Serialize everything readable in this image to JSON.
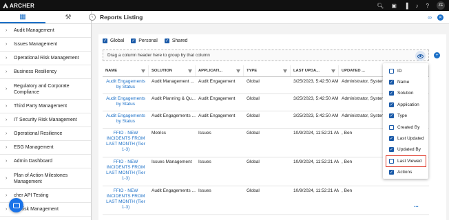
{
  "app": {
    "brand": "ARCHER",
    "user_initials": "ZE"
  },
  "header": {
    "title": "Reports Listing"
  },
  "sidebar": {
    "items": [
      {
        "label": "Audit Management"
      },
      {
        "label": "Issues Management"
      },
      {
        "label": "Operational Risk Management"
      },
      {
        "label": "Business Resiliency"
      },
      {
        "label": "Regulatory and Corporate Compliance"
      },
      {
        "label": "Third Party Management"
      },
      {
        "label": "IT Security Risk Management"
      },
      {
        "label": "Operational Resilience"
      },
      {
        "label": "ESG Management"
      },
      {
        "label": "Admin Dashboard"
      },
      {
        "label": "Plan of Action Milestones Management"
      },
      {
        "label": "cher API Testing"
      },
      {
        "label": "AI Risk Management"
      }
    ]
  },
  "filters": {
    "global": "Global",
    "personal": "Personal",
    "shared": "Shared"
  },
  "groupbar": {
    "text": "Drag a column header here to group by that column"
  },
  "columns": {
    "name": "NAME",
    "solution": "SOLUTION",
    "application": "APPLICATI...",
    "type": "TYPE",
    "last_updated": "LAST UPDA...",
    "updated_by": "UPDATED ..."
  },
  "rows": [
    {
      "name": "Audit Engagements by Status",
      "solution": "Audit Management ...",
      "application": "Audit Engagement",
      "type": "Global",
      "last_updated": "3/25/2023, 5:42:50 AM",
      "updated_by": "Administrator, System"
    },
    {
      "name": "Audit Engagements by Status",
      "solution": "Audit Planning & Qu...",
      "application": "Audit Engagement",
      "type": "Global",
      "last_updated": "3/25/2023, 5:42:50 AM",
      "updated_by": "Administrator, System"
    },
    {
      "name": "Audit Engagements by Status",
      "solution": "Audit Engagements ...",
      "application": "Audit Engagement",
      "type": "Global",
      "last_updated": "3/25/2023, 5:42:50 AM",
      "updated_by": "Administrator, System"
    },
    {
      "name": "FFIO - NEW INCIDENTS FROM LAST MONTH (Tier 1-3)",
      "solution": "Metrics",
      "application": "Issues",
      "type": "Global",
      "last_updated": "10/9/2024, 11:52:21 AM",
      "updated_by": ", Ben"
    },
    {
      "name": "FFIO - NEW INCIDENTS FROM LAST MONTH (Tier 1-3)",
      "solution": "Issues Management",
      "application": "Issues",
      "type": "Global",
      "last_updated": "10/9/2024, 11:52:21 AM",
      "updated_by": ", Ben"
    },
    {
      "name": "FFIO - NEW INCIDENTS FROM LAST MONTH (Tier 1-3)",
      "solution": "Audit Engagements ...",
      "application": "Issues",
      "type": "Global",
      "last_updated": "10/9/2024, 11:52:21 AM",
      "updated_by": ", Ben"
    }
  ],
  "more_label": "...",
  "column_chooser": {
    "items": [
      {
        "label": "ID",
        "checked": false
      },
      {
        "label": "Name",
        "checked": true
      },
      {
        "label": "Solution",
        "checked": true
      },
      {
        "label": "Application",
        "checked": true
      },
      {
        "label": "Type",
        "checked": true
      },
      {
        "label": "Created By",
        "checked": false
      },
      {
        "label": "Last Updated",
        "checked": true
      },
      {
        "label": "Updated By",
        "checked": true
      },
      {
        "label": "Last Viewed",
        "checked": false,
        "highlighted": true
      },
      {
        "label": "Actions",
        "checked": true
      }
    ]
  },
  "colors": {
    "accent": "#1a6fc7",
    "highlight": "#e0392b",
    "topbar": "#111111"
  }
}
